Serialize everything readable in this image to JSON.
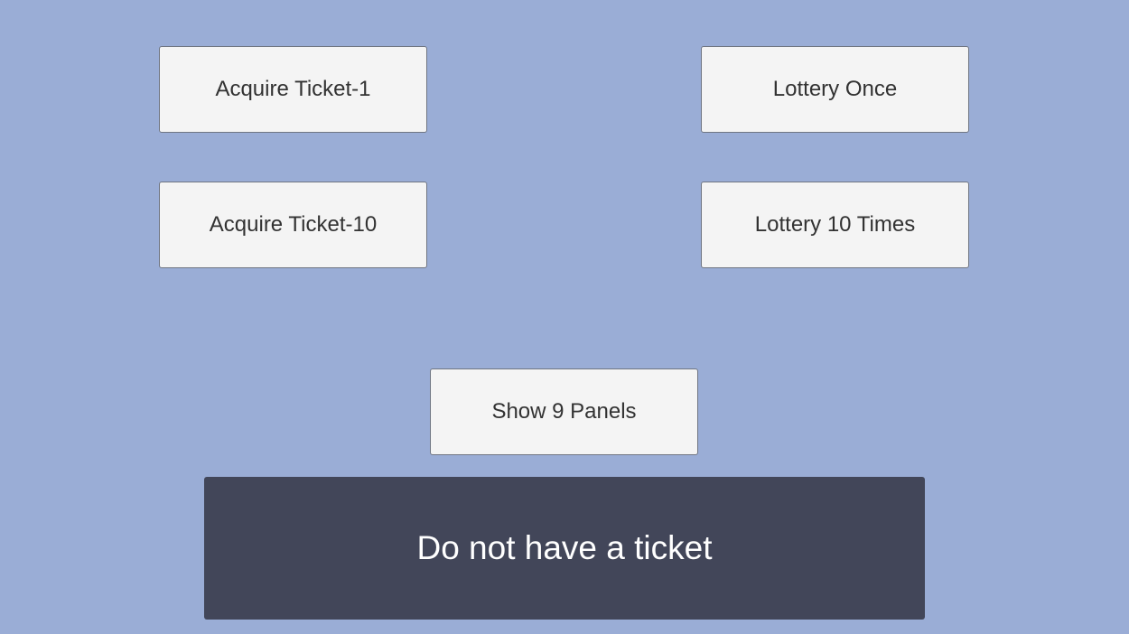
{
  "buttons": {
    "acquire_ticket_1": "Acquire Ticket-1",
    "lottery_once": "Lottery Once",
    "acquire_ticket_10": "Acquire Ticket-10",
    "lottery_10_times": "Lottery 10 Times",
    "show_9_panels": "Show 9 Panels"
  },
  "status": {
    "message": "Do not have a ticket"
  },
  "colors": {
    "background": "#9aadd6",
    "button_bg": "#f4f4f4",
    "button_text": "#323232",
    "status_bg": "#424659",
    "status_text": "#ffffff"
  }
}
